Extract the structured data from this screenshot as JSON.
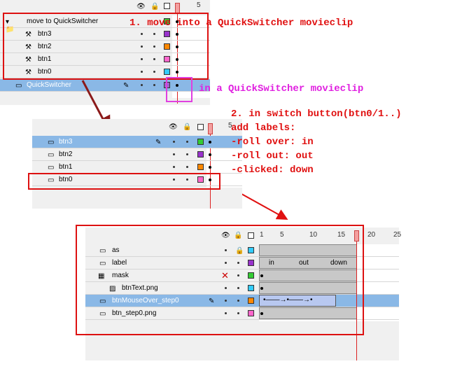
{
  "panel1": {
    "frame_num": "5",
    "layers": [
      {
        "name": "move to QuickSwitcher",
        "color": "#33cc33"
      },
      {
        "name": "btn3",
        "color": "#9933cc"
      },
      {
        "name": "btn2",
        "color": "#ff8800"
      },
      {
        "name": "btn1",
        "color": "#ff66cc"
      },
      {
        "name": "btn0",
        "color": "#33ccff"
      },
      {
        "name": "QuickSwitcher",
        "color": "#9966cc"
      }
    ]
  },
  "panel2": {
    "frame_num": "5",
    "layers": [
      {
        "name": "btn3",
        "color": "#33cc33"
      },
      {
        "name": "btn2",
        "color": "#9933cc"
      },
      {
        "name": "btn1",
        "color": "#ff8800"
      },
      {
        "name": "btn0",
        "color": "#ff66cc"
      }
    ]
  },
  "panel3": {
    "ticks": [
      "1",
      "5",
      "10",
      "15",
      "20",
      "25"
    ],
    "layers": [
      {
        "name": "as",
        "color": "#33ccff"
      },
      {
        "name": "label",
        "color": "#9933cc"
      },
      {
        "name": "mask",
        "color": "#33cc33"
      },
      {
        "name": "btnText.png",
        "color": "#33ccff"
      },
      {
        "name": "btnMouseOver_step0",
        "color": "#ff8800"
      },
      {
        "name": "btn_step0.png",
        "color": "#ff66cc"
      }
    ],
    "labels": [
      "in",
      "out",
      "down"
    ]
  },
  "annotations": {
    "step1": "1. move into a QuickSwitcher movieclip",
    "inqs": "in a QuickSwitcher movieclip",
    "step2_lines": [
      "2. in switch button(btn0/1..)",
      "add labels:",
      "-roll over: in",
      "-roll out: out",
      "-clicked: down"
    ]
  },
  "colors": {
    "annotation_red": "#e01010",
    "annotation_magenta": "#e020e0",
    "selection": "#8ab8e6"
  }
}
